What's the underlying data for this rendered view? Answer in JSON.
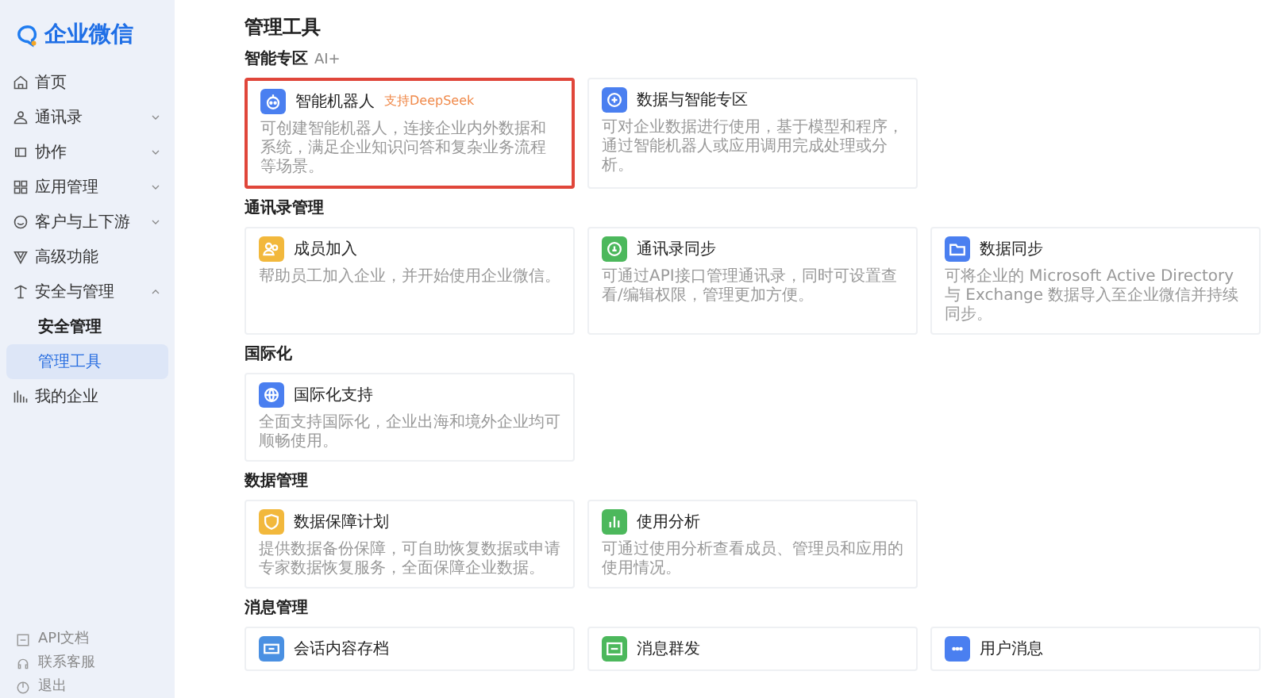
{
  "logo": {
    "text": "企业微信"
  },
  "sidebar": {
    "items": [
      {
        "label": "首页",
        "expandable": false
      },
      {
        "label": "通讯录",
        "expandable": true,
        "expanded": false
      },
      {
        "label": "协作",
        "expandable": true,
        "expanded": false
      },
      {
        "label": "应用管理",
        "expandable": true,
        "expanded": false
      },
      {
        "label": "客户与上下游",
        "expandable": true,
        "expanded": false
      },
      {
        "label": "高级功能",
        "expandable": false
      },
      {
        "label": "安全与管理",
        "expandable": true,
        "expanded": true,
        "children": [
          {
            "label": "安全管理",
            "selected": false
          },
          {
            "label": "管理工具",
            "selected": true
          }
        ]
      },
      {
        "label": "我的企业",
        "expandable": false
      }
    ],
    "footer": [
      {
        "label": "API文档"
      },
      {
        "label": "联系客服"
      },
      {
        "label": "退出"
      }
    ]
  },
  "page_title": "管理工具",
  "sections": [
    {
      "title": "智能专区",
      "suffix": "AI+",
      "cards": [
        {
          "title": "智能机器人",
          "badge": "支持DeepSeek",
          "description": "可创建智能机器人，连接企业内外数据和系统，满足企业知识问答和复杂业务流程等场景。",
          "color": "#4a7ff0",
          "highlighted": true
        },
        {
          "title": "数据与智能专区",
          "description": "可对企业数据进行使用，基于模型和程序，通过智能机器人或应用调用完成处理或分析。",
          "color": "#4a7ff0",
          "highlighted": false
        }
      ]
    },
    {
      "title": "通讯录管理",
      "cards": [
        {
          "title": "成员加入",
          "description": "帮助员工加入企业，并开始使用企业微信。",
          "color": "#f2b83c",
          "highlighted": false
        },
        {
          "title": "通讯录同步",
          "description": "可通过API接口管理通讯录，同时可设置查看/编辑权限，管理更加方便。",
          "color": "#4cb85c",
          "highlighted": false
        },
        {
          "title": "数据同步",
          "description": "可将企业的 Microsoft Active Directory 与 Exchange 数据导入至企业微信并持续同步。",
          "color": "#4a7ff0",
          "highlighted": false
        }
      ]
    },
    {
      "title": "国际化",
      "cards": [
        {
          "title": "国际化支持",
          "description": "全面支持国际化，企业出海和境外企业均可顺畅使用。",
          "color": "#4a7ff0",
          "highlighted": false
        }
      ]
    },
    {
      "title": "数据管理",
      "cards": [
        {
          "title": "数据保障计划",
          "description": "提供数据备份保障，可自助恢复数据或申请专家数据恢复服务，全面保障企业数据。",
          "color": "#f2b83c",
          "highlighted": false
        },
        {
          "title": "使用分析",
          "description": "可通过使用分析查看成员、管理员和应用的使用情况。",
          "color": "#4cb85c",
          "highlighted": false
        }
      ]
    },
    {
      "title": "消息管理",
      "cards": [
        {
          "title": "会话内容存档",
          "color": "#4a90e2",
          "highlighted": false
        },
        {
          "title": "消息群发",
          "color": "#4cb85c",
          "highlighted": false
        },
        {
          "title": "用户消息",
          "color": "#4a7ff0",
          "highlighted": false
        }
      ]
    }
  ]
}
